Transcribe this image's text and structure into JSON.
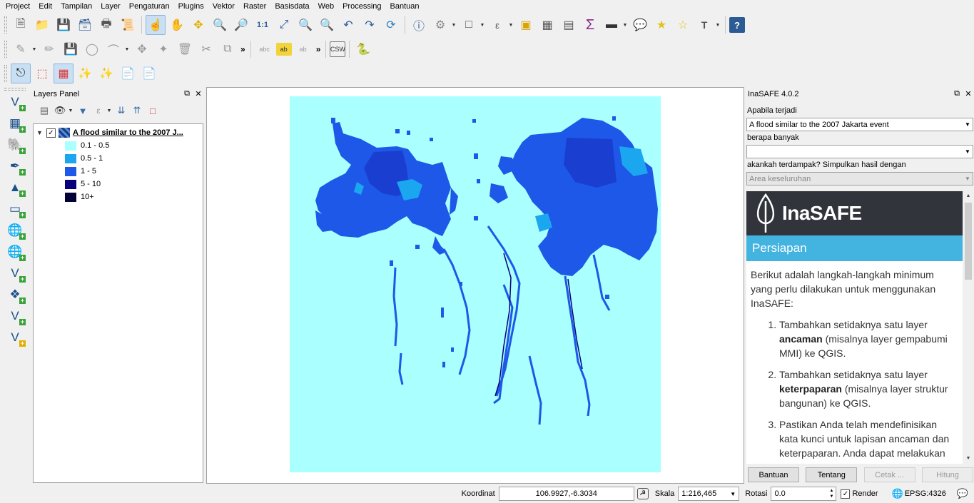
{
  "menu": [
    "Project",
    "Edit",
    "Tampilan",
    "Layer",
    "Pengaturan",
    "Plugins",
    "Vektor",
    "Raster",
    "Basisdata",
    "Web",
    "Processing",
    "Bantuan"
  ],
  "toolbar_icons": {
    "tb1": [
      "new-project-icon",
      "open-project-icon",
      "save-project-icon",
      "save-as-icon",
      "print-composer-icon",
      "composer-manager-icon",
      "touch-zoom-icon",
      "pan-icon",
      "pan-to-selection-icon",
      "zoom-in-icon",
      "zoom-out-icon",
      "zoom-native-icon",
      "zoom-full-icon",
      "zoom-to-selection-icon",
      "zoom-to-layer-icon",
      "zoom-last-icon",
      "zoom-next-icon",
      "refresh-icon",
      "identify-icon",
      "actions-icon",
      "select-icon",
      "select-expression-icon",
      "deselect-icon",
      "attribute-table-icon",
      "field-calculator-icon",
      "statistics-icon",
      "measure-icon",
      "map-tips-icon",
      "new-bookmark-icon",
      "show-bookmarks-icon",
      "text-annotation-icon",
      "help-icon"
    ],
    "tb2_label_badges": {
      "abc": "abc",
      "csw": "CSW"
    }
  },
  "layers_panel": {
    "title": "Layers Panel",
    "layer_name": "A flood similar to the 2007 J...",
    "legend": [
      {
        "label": "0.1 - 0.5",
        "color": "#aaffff"
      },
      {
        "label": "0.5 - 1",
        "color": "#1aa7f0"
      },
      {
        "label": "1 - 5",
        "color": "#1e58e8"
      },
      {
        "label": "5 - 10",
        "color": "#07007a"
      },
      {
        "label": "10+",
        "color": "#020036"
      }
    ]
  },
  "inasafe": {
    "title": "InaSAFE 4.0.2",
    "q1_label": "Apabila terjadi",
    "q1_value": "A flood similar to the 2007 Jakarta event",
    "q2_label": "berapa banyak",
    "q2_value": "",
    "q3_label": "akankah terdampak? Simpulkan hasil dengan",
    "q3_value": "Area keseluruhan",
    "brand": "InaSAFE",
    "section": "Persiapan",
    "intro": "Berikut adalah langkah-langkah minimum yang perlu dilakukan untuk menggunakan InaSAFE:",
    "steps": [
      {
        "pre": "Tambahkan setidaknya satu layer ",
        "bold": "ancaman",
        "post": " (misalnya layer gempabumi MMI) ke QGIS."
      },
      {
        "pre": "Tambahkan setidaknya satu layer ",
        "bold": "keterpaparan",
        "post": " (misalnya layer struktur bangunan) ke QGIS."
      },
      {
        "pre": "Pastikan Anda telah mendefinisikan kata kunci untuk lapisan ancaman dan keterpaparan. Anda dapat melakukan",
        "bold": "",
        "post": ""
      }
    ],
    "buttons": {
      "help": "Bantuan",
      "about": "Tentang",
      "print": "Cetak ...",
      "run": "Hitung"
    }
  },
  "status": {
    "coord_label": "Koordinat",
    "coord_value": "106.9927,-6.3034",
    "scale_label": "Skala",
    "scale_value": "1:216,465",
    "rotation_label": "Rotasi",
    "rotation_value": "0.0",
    "render_label": "Render",
    "crs": "EPSG:4326"
  }
}
